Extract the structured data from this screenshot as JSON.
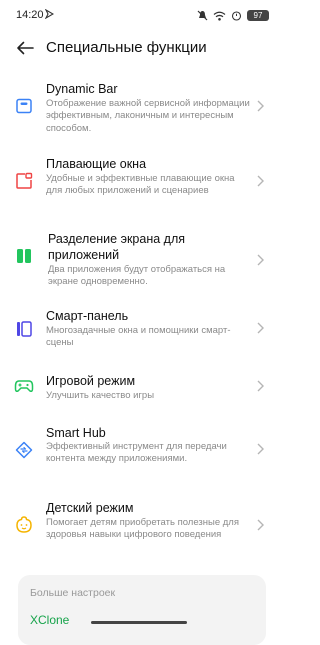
{
  "status": {
    "time": "14:20",
    "battery": "97"
  },
  "header": {
    "title": "Специальные функции"
  },
  "items": [
    {
      "title": "Dynamic Bar",
      "desc": "Отображение важной сервисной информации эффективным, лаконичным и интересным способом.",
      "icon": "dynamic-bar-icon"
    },
    {
      "title": "Плавающие окна",
      "desc": "Удобные и эффективные плавающие окна для любых приложений и сценариев",
      "icon": "floating-window-icon"
    },
    {
      "title1": "Разделение экрана для",
      "title2": "приложений",
      "desc": "Два приложения будут отображаться на экране одновременно.",
      "icon": "split-screen-icon"
    },
    {
      "title": "Смарт-панель",
      "desc": "Многозадачные окна и помощники смарт-сцены",
      "icon": "smart-panel-icon"
    },
    {
      "title": "Игровой режим",
      "desc": "Улучшить качество игры",
      "icon": "gamepad-icon"
    },
    {
      "title": "Smart Hub",
      "desc": "Эффективный инструмент для передачи контента между приложениями.",
      "icon": "smart-hub-icon"
    },
    {
      "title": "Детский режим",
      "desc": "Помогает детям приобретать полезные для здоровья навыки цифрового поведения",
      "icon": "kids-mode-icon"
    }
  ],
  "more": {
    "title": "Больше настроек",
    "link": "XClone"
  },
  "colors": {
    "accent": "#16a34a",
    "blue": "#3b82f6",
    "red": "#ef4444",
    "green": "#22c55e",
    "purple": "#4f46e5",
    "yellow": "#f5b400"
  }
}
